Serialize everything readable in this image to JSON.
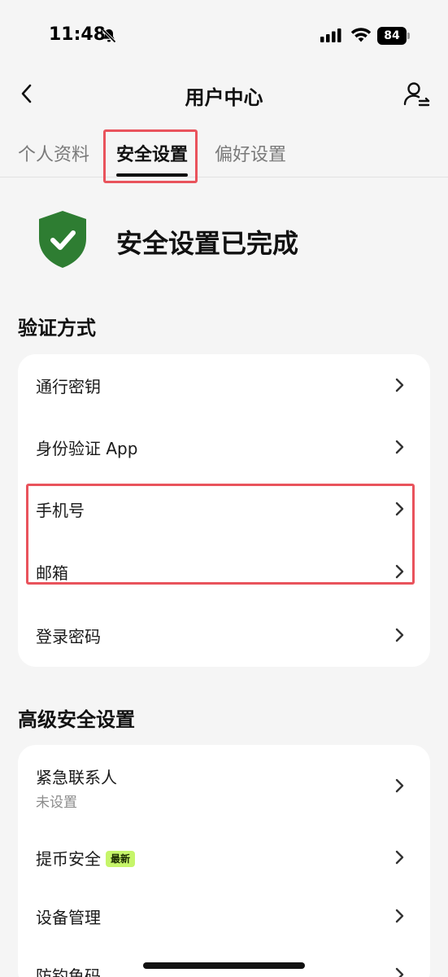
{
  "status_bar": {
    "time": "11:48",
    "battery": "84"
  },
  "header": {
    "title": "用户中心"
  },
  "tabs": [
    {
      "label": "个人资料",
      "active": false
    },
    {
      "label": "安全设置",
      "active": true
    },
    {
      "label": "偏好设置",
      "active": false
    }
  ],
  "completion": {
    "text": "安全设置已完成",
    "icon": "shield-check-icon",
    "color": "#2e7d32"
  },
  "verification": {
    "title": "验证方式",
    "items": [
      {
        "label": "通行密钥"
      },
      {
        "label": "身份验证 App"
      },
      {
        "label": "手机号"
      },
      {
        "label": "邮箱"
      },
      {
        "label": "登录密码"
      }
    ]
  },
  "advanced": {
    "title": "高级安全设置",
    "items": [
      {
        "label": "紧急联系人",
        "sub": "未设置"
      },
      {
        "label": "提币安全",
        "badge": "最新"
      },
      {
        "label": "设备管理"
      },
      {
        "label": "防钓鱼码"
      }
    ]
  },
  "colors": {
    "highlight": "#e9535c",
    "badge": "#c6f56a",
    "shield": "#2e7d32"
  }
}
